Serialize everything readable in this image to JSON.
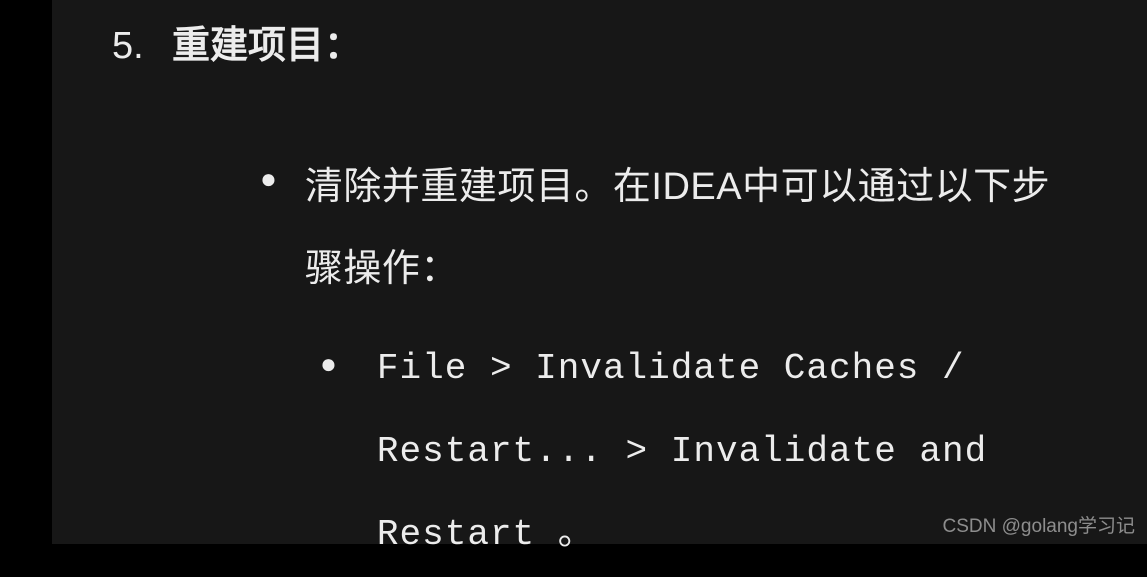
{
  "list": {
    "number": "5.",
    "heading": "重建项目：",
    "bullet": {
      "text": "清除并重建项目。在IDEA中可以通过以下步骤操作：",
      "nested": {
        "code_text": "File > Invalidate Caches / Restart... > Invalidate and Restart 。"
      }
    }
  },
  "watermark": "CSDN @golang学习记"
}
